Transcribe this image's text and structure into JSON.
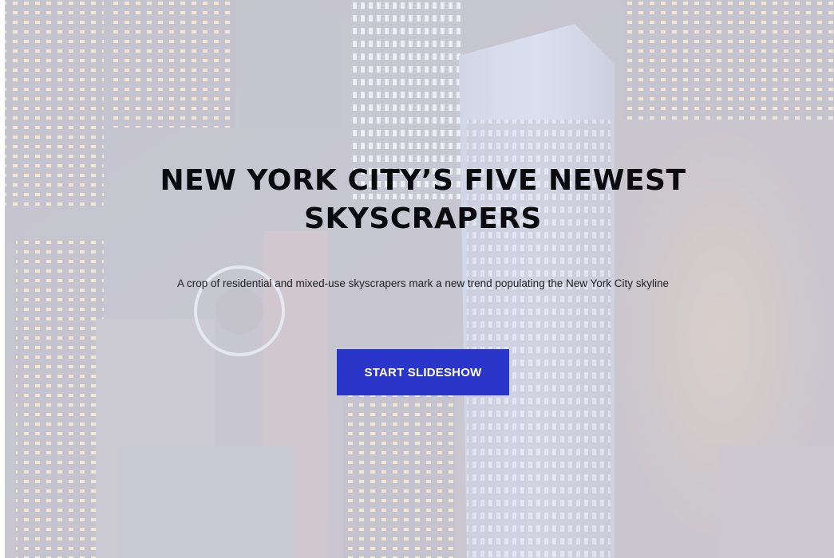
{
  "hero": {
    "title": "NEW YORK CITY’S FIVE NEWEST SKYSCRAPERS",
    "subtitle": "A crop of residential and mixed-use skyscrapers mark a new trend populating the New York City skyline",
    "cta_label": "START SLIDESHOW"
  },
  "colors": {
    "cta_background": "#2a35c9",
    "cta_text": "#ffffff",
    "title_text": "#0a0a0f",
    "overlay": "#f4f3f8"
  },
  "background": {
    "subject": "aerial night view of city skyscrapers"
  }
}
